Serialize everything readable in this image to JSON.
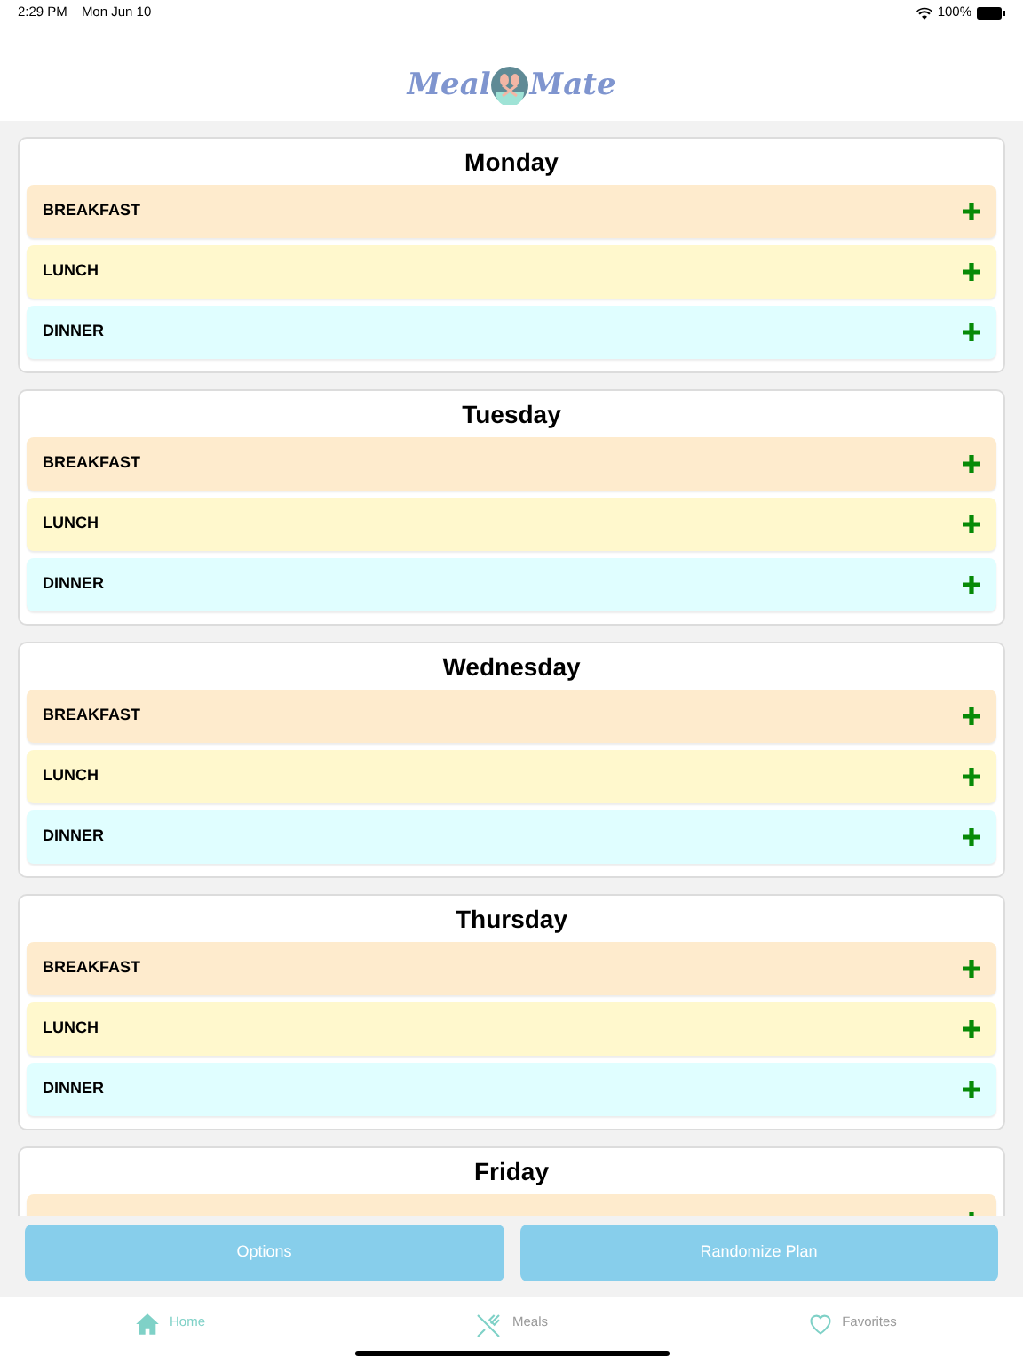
{
  "status_bar": {
    "time": "2:29 PM",
    "date": "Mon Jun 10",
    "battery": "100%"
  },
  "logo": {
    "left": "Meal",
    "right": "Mate"
  },
  "days": [
    {
      "name": "Monday",
      "meals": [
        {
          "label": "BREAKFAST",
          "color": "#feebcd"
        },
        {
          "label": "LUNCH",
          "color": "#fff8cd"
        },
        {
          "label": "DINNER",
          "color": "#e0feff"
        }
      ]
    },
    {
      "name": "Tuesday",
      "meals": [
        {
          "label": "BREAKFAST",
          "color": "#feebcd"
        },
        {
          "label": "LUNCH",
          "color": "#fff8cd"
        },
        {
          "label": "DINNER",
          "color": "#e0feff"
        }
      ]
    },
    {
      "name": "Wednesday",
      "meals": [
        {
          "label": "BREAKFAST",
          "color": "#feebcd"
        },
        {
          "label": "LUNCH",
          "color": "#fff8cd"
        },
        {
          "label": "DINNER",
          "color": "#e0feff"
        }
      ]
    },
    {
      "name": "Thursday",
      "meals": [
        {
          "label": "BREAKFAST",
          "color": "#feebcd"
        },
        {
          "label": "LUNCH",
          "color": "#fff8cd"
        },
        {
          "label": "DINNER",
          "color": "#e0feff"
        }
      ]
    },
    {
      "name": "Friday",
      "meals": [
        {
          "color": "#feebcd"
        }
      ]
    }
  ],
  "actions": [
    "Options",
    "Randomize Plan"
  ],
  "tabs": [
    {
      "label": "Home",
      "kind": "home",
      "selected": true
    },
    {
      "label": "Meals",
      "kind": "meals",
      "selected": false
    },
    {
      "label": "Favorites",
      "kind": "favorites",
      "selected": false
    }
  ]
}
